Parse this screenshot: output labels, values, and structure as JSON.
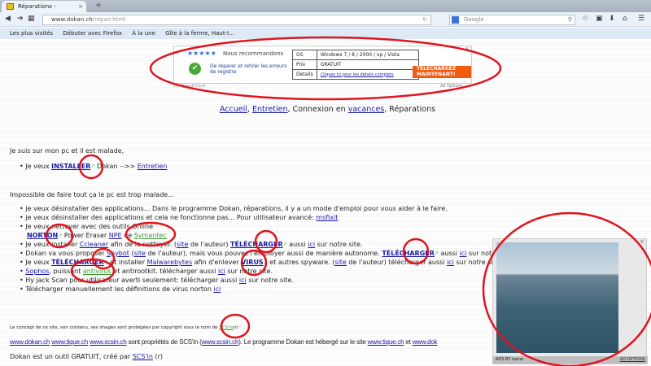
{
  "browser": {
    "tab_title": "Réparations - Dépannage -...",
    "url_domain": "www.dokan.ch",
    "url_path": "/repair.html",
    "search_placeholder": "Google",
    "bookmarks": [
      "Les plus visités",
      "Débuter avec Firefox",
      "À la une",
      "Gîte à la ferme, Haut-I..."
    ]
  },
  "ad": {
    "stars": "★★★★★",
    "recommend": "Nous recommandons",
    "tagline": "De réparer et retirer les erreurs de registre",
    "rows": [
      [
        "OS",
        "Windows 7 / 8 / 2000 / xp / Vista"
      ],
      [
        "Prix",
        "GRATUIT"
      ],
      [
        "Details",
        "Cliquez ici pour les détails complets"
      ]
    ],
    "button": "TÉLÉCHARGEZ MAINTENANT!",
    "brand": "by SpeedCheck",
    "options": "Ad Options"
  },
  "nav": {
    "accueil": "Accueil",
    "entretien": "Entretien",
    "middle": ", Connexion en ",
    "vacances": "vacances",
    "end": ", Réparations"
  },
  "s1": {
    "heading": "Je suis sur mon pc et il est malade,",
    "pre": "Je veux ",
    "installer": "INSTALLER",
    "post": " Dokan  -->> ",
    "entretien": "Entretien"
  },
  "s2": {
    "heading": "Impossible de faire tout ça le pc est trop malade...",
    "b1": "je veux désinstaller des applications... Dans le programme Dokan, réparations, il y a un mode d'emploi pour vous aider à le faire.",
    "b2": "je veux désinstaller des applications et cela ne fonctionne pas... Pour utilisateur avancé: ",
    "msfixit": "msfixit",
    "b3": "Je veux nettoyer avec des outils Online",
    "norton": "NORTON",
    "b3b": " Power Eraser ",
    "npe": "NPE",
    "de": " de ",
    "symantec": "Symantec",
    "b4a": "Je veux installer ",
    "ccleaner": "Ccleaner",
    "b4b": " afin de le nettoyer. (",
    "site": "site",
    "b4c": " de l'auteur) ",
    "telecharger": "TÉLÉCHARGER",
    "b4d": " aussi ",
    "ici": "ici",
    "b4e": " sur notre site.",
    "b5a": "Dokan va vous proposer ",
    "spybot": "Spybot",
    "b5b": " (",
    "b5c": " de l'auteur), mais vous pouvez l'employer aussi de manière autonome. ",
    "b6a": "Je veux ",
    "b6b": " et installer ",
    "malwarebytes": "Malwarebytes",
    "b6c": " afin d'enlever ",
    "virus": "VIRUS",
    "b6d": " et autres spyware. (",
    "b6e": " de l'auteur) télécharger aussi ",
    "sophos": "Sophos",
    "b7a": ", puissant ",
    "antivirus": "antivirus",
    "b7b": " et antirootkit. télécharger aussi ",
    "b8": "Hy jack Scan pour utilisateur averti seulement: télécharger aussi ",
    "b9": "Télécharger manuellement les définitions de virus norton "
  },
  "footer": {
    "copyright": "Le concept de ce site, son contenu, ses images sont protégées par copyright sous le nom de ",
    "scsin": "SCS'in",
    "r": "(r)",
    "l1": "www.dokan.ch",
    "l2": "www.tique.ch",
    "l3": "www.scsin.ch",
    "t1": " sont propriétés de SCS'in (",
    "t2": "). Le programme Dokan est hébergé sur le site ",
    "t3": " et ",
    "l5": "www.dok",
    "free": "Dokan est un outil GRATUIT, créé par ",
    "freer": " (r)"
  },
  "video_ad": {
    "by": "ADS BY name",
    "options": "AD OPTIONS"
  },
  "colors": {
    "annotation": "#e0141e",
    "link": "#1a1aa6",
    "green_link": "#3a9a30",
    "ad_button": "#f25b12"
  }
}
